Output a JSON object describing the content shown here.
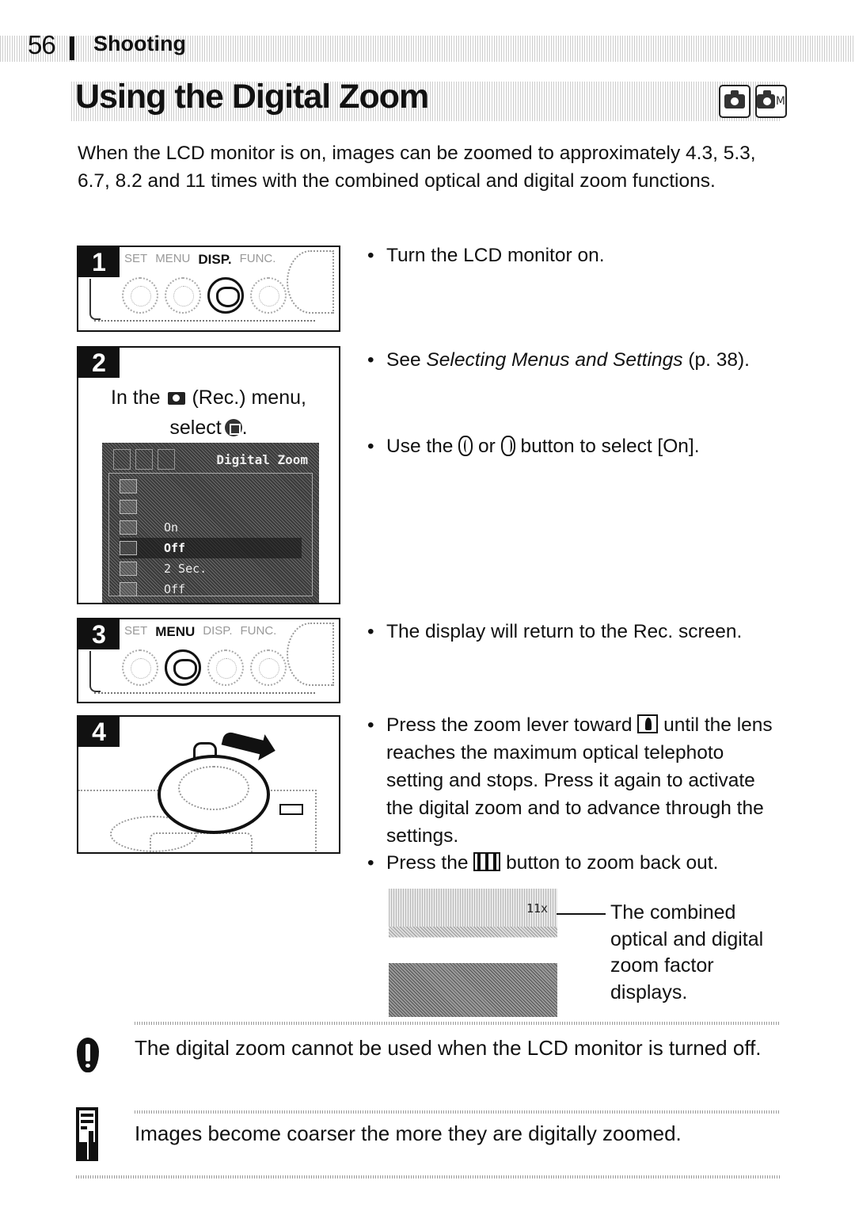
{
  "header": {
    "page_number": "56",
    "section": "Shooting"
  },
  "title": "Using the Digital Zoom",
  "mode_icons": [
    {
      "icon": "camera-auto-icon",
      "label": ""
    },
    {
      "icon": "camera-manual-icon",
      "label": "M"
    }
  ],
  "intro": "When the LCD monitor is on, images can be zoomed to approximately 4.3, 5.3, 6.7, 8.2 and 11 times with the combined optical and digital zoom functions.",
  "steps": [
    {
      "number": "1",
      "buttons": [
        "SET",
        "MENU",
        "DISP.",
        "FUNC."
      ],
      "active_button": "DISP.",
      "bullets": [
        "Turn the LCD monitor on."
      ]
    },
    {
      "number": "2",
      "instruction_prefix": "In the",
      "instruction_rec": "(Rec.) menu,",
      "instruction_select": "select",
      "instruction_end": ".",
      "lcd": {
        "title": "Digital Zoom",
        "rows": [
          {
            "value": ""
          },
          {
            "value": ""
          },
          {
            "value": "On"
          },
          {
            "value": "Off",
            "selected": true
          },
          {
            "value": "2 Sec."
          },
          {
            "value": "Off"
          }
        ]
      },
      "bullets": [
        {
          "pre": "See ",
          "italic": "Selecting Menus and Settings",
          "post": " (p. 38)."
        },
        {
          "pre": "Use the ",
          "mid": " or ",
          "post": " button to select [On]."
        }
      ]
    },
    {
      "number": "3",
      "buttons": [
        "SET",
        "MENU",
        "DISP.",
        "FUNC."
      ],
      "active_button": "MENU",
      "bullets": [
        "The display will return to the Rec. screen."
      ]
    },
    {
      "number": "4",
      "bullets": [
        {
          "pre": "Press the zoom lever toward ",
          "post": " until the lens reaches the maximum optical telephoto setting and stops. Press it again to activate the digital zoom and to advance through the settings."
        },
        {
          "pre": "Press the ",
          "post": " button to zoom back out."
        }
      ]
    }
  ],
  "zoom_photo": {
    "readout": "11x",
    "caption": "The combined optical and digital zoom factor displays."
  },
  "caution": "The digital zoom cannot be used when the LCD monitor is turned off.",
  "note": "Images become coarser the more they are digitally zoomed."
}
